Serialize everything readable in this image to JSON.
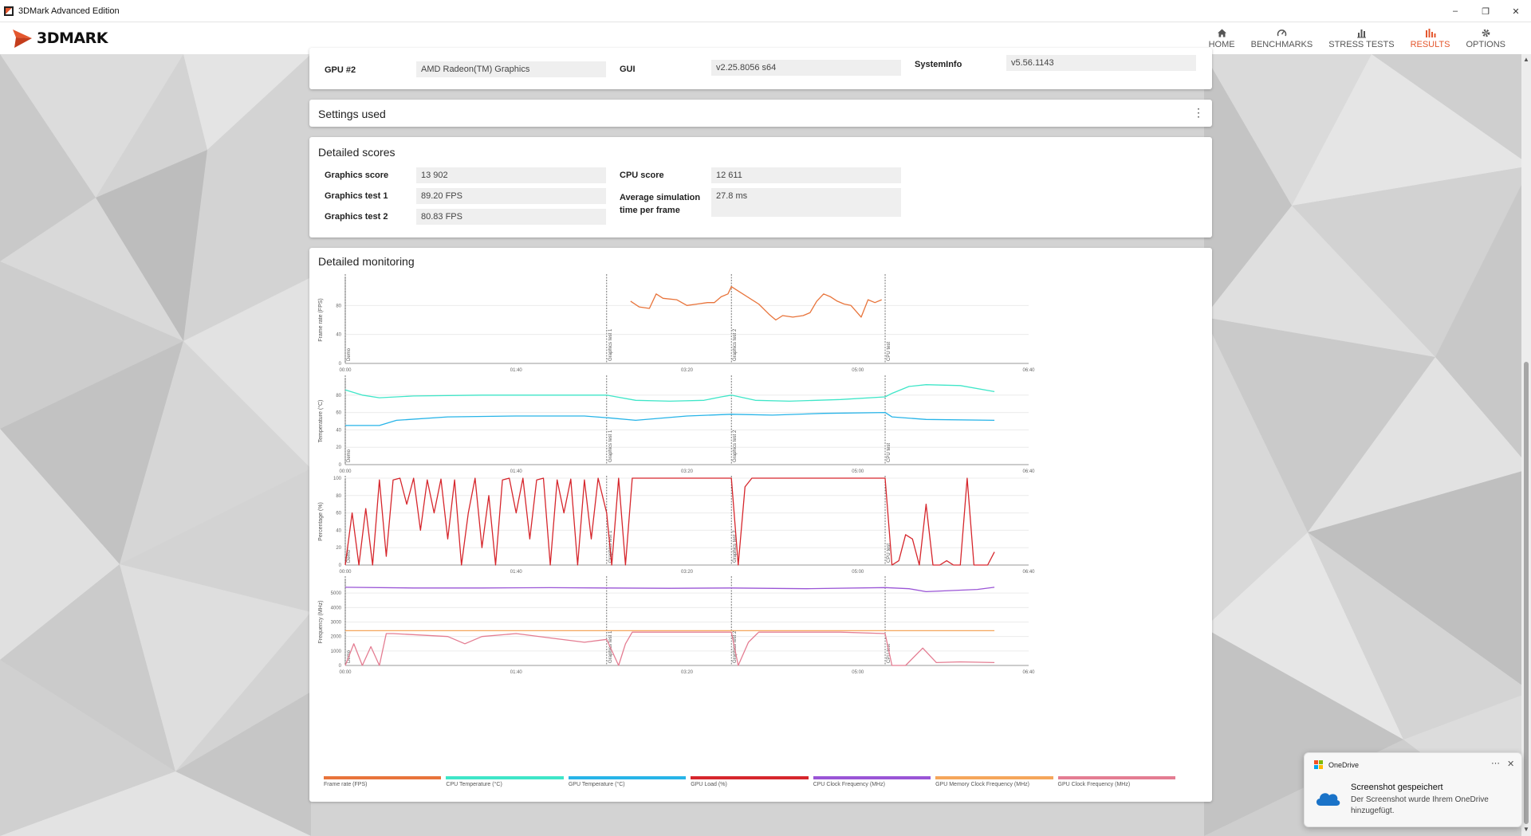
{
  "window": {
    "title": "3DMark Advanced Edition",
    "minimize": "–",
    "restore": "❐",
    "close": "✕"
  },
  "nav": {
    "logo_text": "3DMARK",
    "items": [
      {
        "label": "HOME",
        "icon": "home-icon"
      },
      {
        "label": "BENCHMARKS",
        "icon": "gauge-icon"
      },
      {
        "label": "STRESS TESTS",
        "icon": "bar-chart-icon"
      },
      {
        "label": "RESULTS",
        "icon": "results-icon",
        "active": true
      },
      {
        "label": "OPTIONS",
        "icon": "gear-icon"
      }
    ],
    "accent": "#e4572e"
  },
  "system_panel": {
    "rows": [
      {
        "label": "GPU #2",
        "value": "AMD Radeon(TM) Graphics"
      },
      {
        "label": "GUI",
        "value": "v2.25.8056 s64"
      },
      {
        "label": "SystemInfo",
        "value": "v5.56.1143"
      }
    ]
  },
  "settings_panel": {
    "title": "Settings used",
    "menu_icon": "⋮"
  },
  "scores_panel": {
    "title": "Detailed scores",
    "left": [
      {
        "label": "Graphics score",
        "value": "13 902"
      },
      {
        "label": "Graphics test 1",
        "value": "89.20 FPS"
      },
      {
        "label": "Graphics test 2",
        "value": "80.83 FPS"
      }
    ],
    "right": [
      {
        "label": "CPU score",
        "value": "12 611"
      },
      {
        "label": "Average simulation time per frame",
        "value": "27.8 ms"
      }
    ]
  },
  "monitoring": {
    "title": "Detailed monitoring",
    "x_ticks": [
      "00:00",
      "01:40",
      "03:20",
      "05:00",
      "06:40"
    ],
    "phase_labels": [
      "Demo",
      "Graphics test 1",
      "Graphics test 2",
      "CPU test"
    ],
    "legend": [
      {
        "name": "Frame rate (FPS)",
        "color": "#e8743b"
      },
      {
        "name": "CPU Temperature (°C)",
        "color": "#3fe6c8"
      },
      {
        "name": "GPU Temperature (°C)",
        "color": "#27b4e8"
      },
      {
        "name": "GPU Load (%)",
        "color": "#d6262c"
      },
      {
        "name": "CPU Clock Frequency (MHz)",
        "color": "#9a55d6"
      },
      {
        "name": "GPU Memory Clock Frequency (MHz)",
        "color": "#f5a65b"
      },
      {
        "name": "GPU Clock Frequency (MHz)",
        "color": "#e47d92"
      }
    ],
    "y_labels": [
      "Frame rate (FPS)",
      "Temperature (°C)",
      "Percentage (%)",
      "Frequency (MHz)"
    ],
    "y_ticks": [
      [
        "0",
        "40",
        "80"
      ],
      [
        "0",
        "20",
        "40",
        "60",
        "80"
      ],
      [
        "0",
        "20",
        "40",
        "60",
        "80",
        "100"
      ],
      [
        "0",
        "1000",
        "2000",
        "3000",
        "4000",
        "5000"
      ]
    ]
  },
  "chart_data": [
    {
      "type": "line",
      "ylabel": "Frame rate (FPS)",
      "xlim_seconds": [
        0,
        400
      ],
      "x_ticks": [
        "00:00",
        "01:40",
        "03:20",
        "05:00",
        "06:40"
      ],
      "ylim": [
        0,
        120
      ],
      "phase_markers_seconds": [
        0,
        153,
        226,
        316
      ],
      "series": [
        {
          "name": "Frame rate (FPS)",
          "x": [
            167,
            172,
            178,
            182,
            186,
            194,
            200,
            206,
            212,
            216,
            220,
            224,
            226,
            242,
            248,
            252,
            256,
            262,
            268,
            272,
            276,
            280,
            284,
            288,
            292,
            296,
            302,
            306,
            310,
            314
          ],
          "y": [
            86,
            78,
            76,
            96,
            90,
            88,
            80,
            82,
            84,
            84,
            92,
            96,
            106,
            82,
            68,
            60,
            66,
            64,
            66,
            70,
            86,
            96,
            92,
            86,
            82,
            80,
            64,
            88,
            84,
            88
          ]
        }
      ]
    },
    {
      "type": "line",
      "ylabel": "Temperature (°C)",
      "xlim_seconds": [
        0,
        400
      ],
      "ylim": [
        0,
        100
      ],
      "series": [
        {
          "name": "CPU Temperature (°C)",
          "x": [
            0,
            10,
            20,
            40,
            80,
            120,
            153,
            170,
            190,
            210,
            220,
            226,
            240,
            260,
            290,
            316,
            320,
            330,
            340,
            360,
            380
          ],
          "y": [
            86,
            80,
            77,
            79,
            80,
            80,
            80,
            74,
            73,
            74,
            78,
            80,
            74,
            73,
            75,
            78,
            82,
            90,
            92,
            91,
            84
          ]
        },
        {
          "name": "GPU Temperature (°C)",
          "x": [
            0,
            20,
            30,
            60,
            100,
            140,
            153,
            170,
            200,
            226,
            250,
            280,
            316,
            320,
            340,
            380
          ],
          "y": [
            45,
            45,
            51,
            55,
            56,
            56,
            54,
            51,
            56,
            58,
            57,
            59,
            60,
            55,
            52,
            51
          ]
        }
      ]
    },
    {
      "type": "line",
      "ylabel": "Percentage (%)",
      "xlim_seconds": [
        0,
        400
      ],
      "ylim": [
        0,
        100
      ],
      "series": [
        {
          "name": "GPU Load (%)",
          "x": [
            0,
            4,
            8,
            12,
            16,
            20,
            24,
            28,
            32,
            36,
            40,
            44,
            48,
            52,
            56,
            60,
            64,
            68,
            72,
            76,
            80,
            84,
            88,
            92,
            96,
            100,
            104,
            108,
            112,
            116,
            120,
            124,
            128,
            132,
            136,
            140,
            144,
            148,
            153,
            156,
            160,
            164,
            168,
            226,
            230,
            234,
            238,
            242,
            316,
            320,
            324,
            328,
            332,
            336,
            340,
            344,
            348,
            352,
            356,
            360,
            364,
            368,
            372,
            376,
            380
          ],
          "y": [
            0,
            60,
            0,
            65,
            0,
            98,
            10,
            98,
            100,
            70,
            100,
            40,
            98,
            60,
            99,
            30,
            98,
            0,
            60,
            100,
            20,
            80,
            0,
            98,
            100,
            60,
            100,
            30,
            98,
            100,
            0,
            98,
            60,
            99,
            0,
            98,
            30,
            100,
            60,
            0,
            100,
            0,
            100,
            100,
            0,
            90,
            100,
            100,
            100,
            0,
            5,
            35,
            30,
            0,
            70,
            0,
            0,
            5,
            0,
            0,
            100,
            0,
            0,
            0,
            15
          ]
        }
      ]
    },
    {
      "type": "line",
      "ylabel": "Frequency (MHz)",
      "xlim_seconds": [
        0,
        400
      ],
      "ylim": [
        0,
        6000
      ],
      "series": [
        {
          "name": "CPU Clock Frequency (MHz)",
          "x": [
            0,
            40,
            80,
            120,
            153,
            190,
            226,
            270,
            316,
            330,
            340,
            370,
            380
          ],
          "y": [
            5400,
            5350,
            5350,
            5370,
            5350,
            5330,
            5350,
            5300,
            5380,
            5300,
            5100,
            5250,
            5400
          ]
        },
        {
          "name": "GPU Memory Clock Frequency (MHz)",
          "x": [
            0,
            380
          ],
          "y": [
            2400,
            2400
          ]
        },
        {
          "name": "GPU Clock Frequency (MHz)",
          "x": [
            0,
            5,
            10,
            15,
            20,
            24,
            28,
            60,
            70,
            80,
            100,
            120,
            140,
            153,
            160,
            164,
            168,
            226,
            230,
            236,
            242,
            290,
            316,
            320,
            328,
            338,
            346,
            360,
            380
          ],
          "y": [
            0,
            1500,
            0,
            1300,
            0,
            2200,
            2200,
            2000,
            1500,
            2000,
            2200,
            1900,
            1600,
            1800,
            0,
            1500,
            2300,
            2300,
            0,
            1600,
            2300,
            2300,
            2200,
            0,
            0,
            1200,
            200,
            250,
            200
          ]
        }
      ]
    }
  ],
  "toast": {
    "app": "OneDrive",
    "title": "Screenshot gespeichert",
    "body": "Der Screenshot wurde Ihrem OneDrive hinzugefügt.",
    "dots": "⋯",
    "close": "✕"
  }
}
